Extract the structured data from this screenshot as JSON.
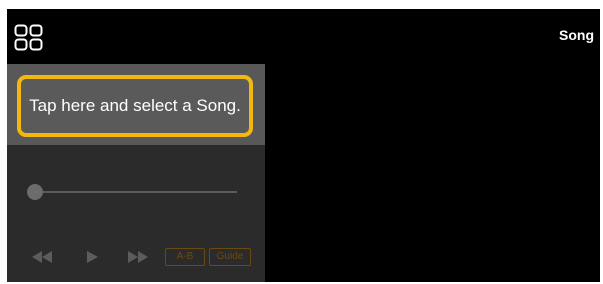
{
  "header": {
    "menu_icon": "grid-menu-icon",
    "title": "Song"
  },
  "song_selector": {
    "label": "Tap here and select a Song."
  },
  "seek_slider": {
    "position": 0
  },
  "transport": {
    "rewind_icon": "rewind-icon",
    "play_icon": "play-icon",
    "fast_forward_icon": "fast-forward-icon",
    "ab_label": "A-B",
    "guide_label": "Guide"
  },
  "colors": {
    "background": "#000000",
    "panel": "#2b2b2b",
    "song_strip": "#585858",
    "highlight": "#f2b810",
    "disabled_accent": "#6b4a10"
  }
}
